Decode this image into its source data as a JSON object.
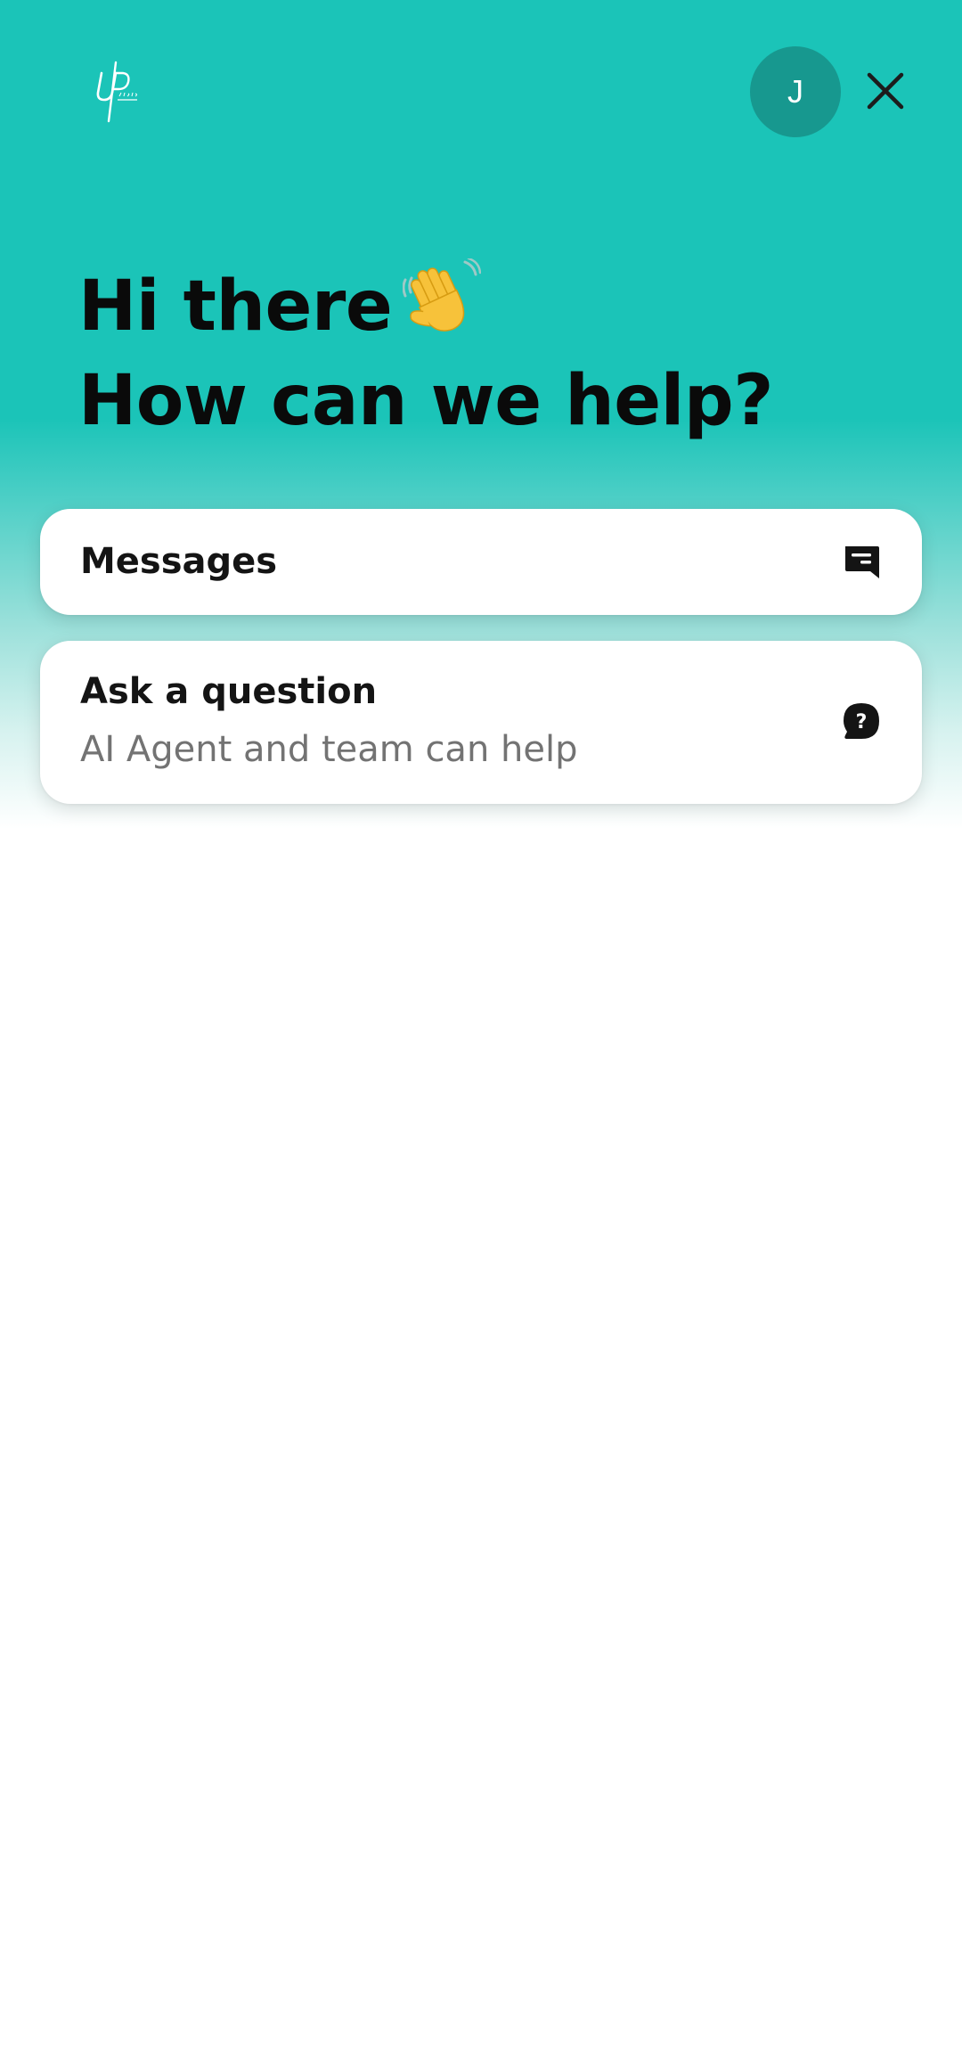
{
  "header": {
    "logo_icon": "up-rides-logo",
    "avatar_initial": "J",
    "close_icon": "close-icon",
    "brand_color": "#1bc4b8",
    "avatar_color": "#17988f"
  },
  "greeting": {
    "line1": "Hi there",
    "wave_icon": "waving-hand-icon",
    "line2": "How can we help?"
  },
  "cards": {
    "messages": {
      "title": "Messages",
      "icon": "message-icon"
    },
    "ask": {
      "title": "Ask a question",
      "subtitle": "AI Agent and team can help",
      "icon": "question-bubble-icon"
    }
  }
}
